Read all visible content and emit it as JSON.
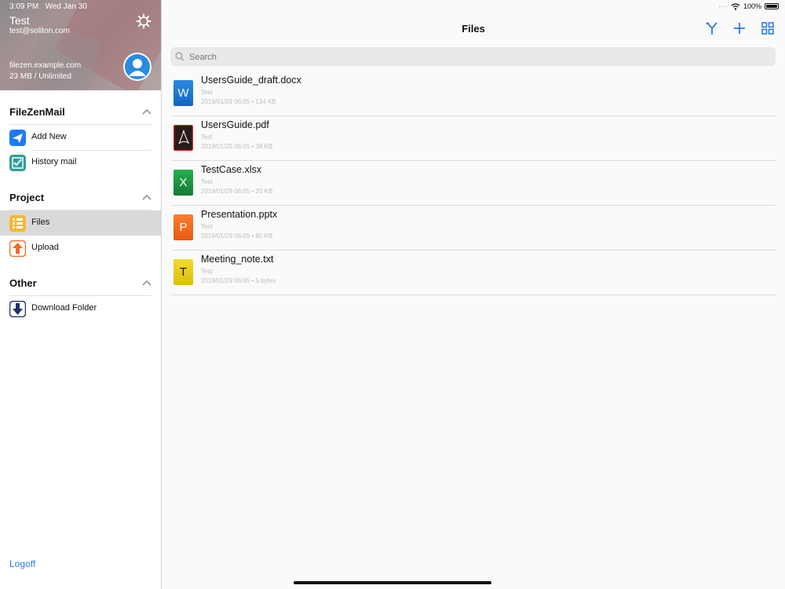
{
  "status_bar": {
    "time": "3:09 PM",
    "date": "Wed Jan 30",
    "battery": "100%"
  },
  "account": {
    "name": "Test",
    "email": "test@soliton.com",
    "server": "filezen.example.com",
    "quota": "23 MB / Unlimited"
  },
  "sidebar": {
    "sections": [
      {
        "title": "FileZenMail",
        "items": [
          {
            "label": "Add New",
            "icon": "paper-plane-icon",
            "color": "#1e7cf2"
          },
          {
            "label": "History mail",
            "icon": "checkbox-icon",
            "color": "#2aa198"
          }
        ]
      },
      {
        "title": "Project",
        "items": [
          {
            "label": "Files",
            "icon": "files-list-icon",
            "color": "#f7b733"
          },
          {
            "label": "Upload",
            "icon": "upload-arrow-icon",
            "color": "#f26b21"
          }
        ]
      },
      {
        "title": "Other",
        "items": [
          {
            "label": "Download Folder",
            "icon": "download-arrow-icon",
            "color": "#1f2d6b"
          }
        ]
      }
    ],
    "logoff": "Logoff"
  },
  "main": {
    "title": "Files",
    "toolbar_icons": [
      "merge-icon",
      "plus-icon",
      "grid-icon"
    ],
    "accent": "#2f7ae5",
    "search_placeholder": "Search",
    "files": [
      {
        "name": "UsersGuide_draft.docx",
        "owner": "Test",
        "meta": "2019/01/29 06:05 • 134 KB",
        "letter": "W",
        "color": "#1f7fd6"
      },
      {
        "name": "UsersGuide.pdf",
        "owner": "Test",
        "meta": "2019/01/29 06:05 • 38 KB",
        "letter": "",
        "color": "#2a1a1a"
      },
      {
        "name": "TestCase.xlsx",
        "owner": "Test",
        "meta": "2019/01/29 06:05 • 20 KB",
        "letter": "X",
        "color": "#1e9b44"
      },
      {
        "name": "Presentation.pptx",
        "owner": "Test",
        "meta": "2019/01/29 06:05 • 80 KB",
        "letter": "P",
        "color": "#f26b21"
      },
      {
        "name": "Meeting_note.txt",
        "owner": "Test",
        "meta": "2019/01/29 06:05 • 5 bytes",
        "letter": "T",
        "color": "#e8cc1c"
      }
    ]
  }
}
